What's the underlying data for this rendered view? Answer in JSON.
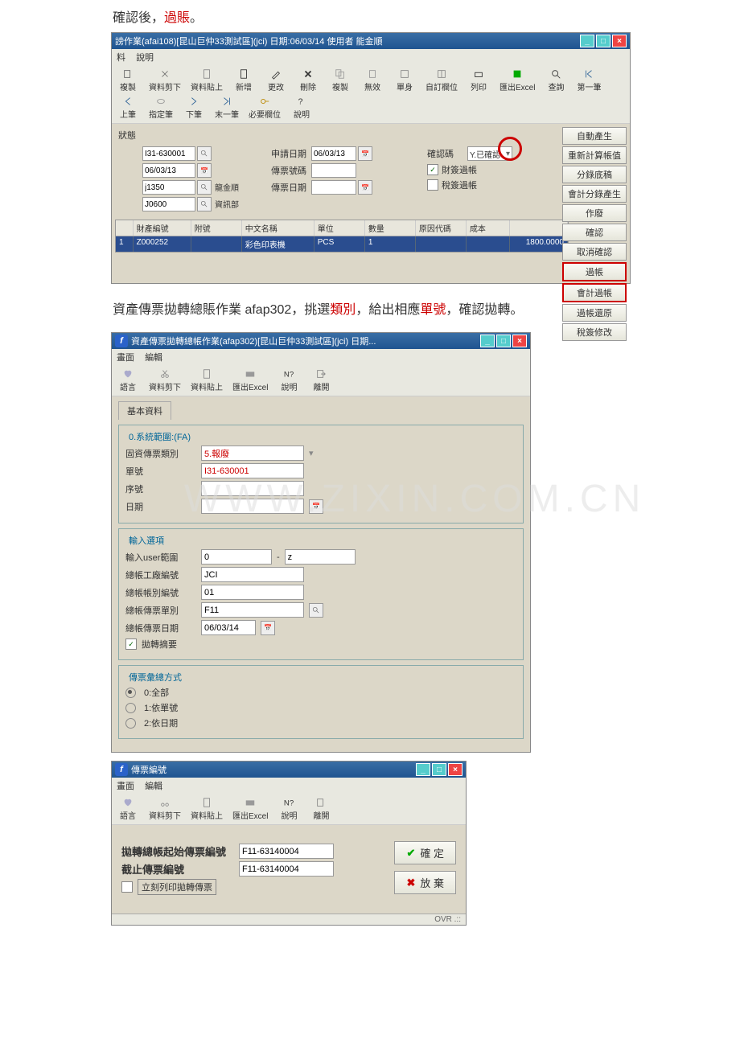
{
  "doc": {
    "line1_a": "確認後，",
    "line1_b": "過賬",
    "line1_c": "。",
    "line2_a": "資產傳票拋轉總賬作業 afap302，挑選",
    "line2_b": "類別",
    "line2_c": "，給出相應",
    "line2_d": "單號",
    "line2_e": "，確認拋轉。"
  },
  "win1": {
    "title": "謗作業(afai108)[昆山巨仲33測試區](jci)  日期:06/03/14  使用者 能金順",
    "menu": {
      "m1": "料",
      "m2": "說明"
    },
    "tool": {
      "t1": "複製",
      "t2": "資料剪下",
      "t3": "資料貼上",
      "t4": "新增",
      "t5": "更改",
      "t6": "刪除",
      "t7": "複製",
      "t8": "無效",
      "t9": "單身",
      "t10": "自訂欄位",
      "t11": "列印",
      "t12": "匯出Excel",
      "t13": "查詢",
      "t14": "第一筆",
      "t15": "上筆",
      "t16": "指定筆",
      "t17": "下筆",
      "t18": "末一筆",
      "t19": "必要欄位",
      "t20": "說明"
    },
    "status": "狀態",
    "left": {
      "f1": "I31-630001",
      "f2": "06/03/13",
      "f3": "j1350",
      "f4": "J0600",
      "v3": "龍金順",
      "v4": "資訊部"
    },
    "mid": {
      "l1": "申請日期",
      "v1": "06/03/13",
      "l2": "傳票號碼",
      "l3": "傳票日期"
    },
    "right": {
      "l1": "確認碼",
      "v1": "Y.已確認",
      "c1": "財簽過帳",
      "c2": "稅簽過帳"
    },
    "side": {
      "b1": "自動產生",
      "b2": "重新計算帳值",
      "b3": "分錄底稿",
      "b4": "會計分錄產生",
      "b5": "作廢",
      "b6": "確認",
      "b7": "取消確認",
      "b8": "過帳",
      "b9": "會計過帳",
      "b10": "過帳還原",
      "b11": "稅簽修改"
    },
    "thead": {
      "h1": "財產編號",
      "h2": "附號",
      "h3": "中文名稱",
      "h4": "單位",
      "h5": "數量",
      "h6": "原因代碼",
      "h7": "成本"
    },
    "trow": {
      "n": "1",
      "c2": "Z000252",
      "c4": "彩色印表機",
      "c5": "PCS",
      "c6": "1",
      "c9": "1800.0000"
    }
  },
  "win2": {
    "title": "資產傳票拋轉總帳作業(afap302)[昆山巨仲33測試區](jci)  日期...",
    "menu": {
      "m1": "畫面",
      "m2": "編輯"
    },
    "tool": {
      "t1": "語言",
      "t2": "資料剪下",
      "t3": "資料貼上",
      "t4": "匯出Excel",
      "t5": "說明",
      "t6": "離開"
    },
    "tab": "基本資料",
    "fs0": "0.系統範圍:(FA)",
    "r1l": "固資傳票類別",
    "r1v": "5.報廢",
    "r2l": "單號",
    "r2v": "I31-630001",
    "r3l": "序號",
    "r4l": "日期",
    "fs1": "輸入選項",
    "r5l": "輸入user範圍",
    "r5a": "0",
    "r5b": "z",
    "r6l": "總帳工廠編號",
    "r6v": "JCI",
    "r7l": "總帳帳別編號",
    "r7v": "01",
    "r8l": "總帳傳票單別",
    "r8v": "F11",
    "r9l": "總帳傳票日期",
    "r9v": "06/03/14",
    "r10": "拋轉摘要",
    "fs2": "傳票彙總方式",
    "o0": "0:全部",
    "o1": "1:依單號",
    "o2": "2:依日期"
  },
  "win3": {
    "title": "傳票編號",
    "menu": {
      "m1": "畫面",
      "m2": "編輯"
    },
    "tool": {
      "t1": "語言",
      "t2": "資料剪下",
      "t3": "資料貼上",
      "t4": "匯出Excel",
      "t5": "說明",
      "t6": "離開"
    },
    "l1": "拋轉總帳起始傳票編號",
    "v1": "F11-63140004",
    "l2": "截止傳票編號",
    "v2": "F11-63140004",
    "chk": "立刻列印拋轉傳票",
    "ok": "確 定",
    "cancel": "放 棄",
    "status": "OVR"
  },
  "wm": "WWW.ZIXIN.COM.CN"
}
